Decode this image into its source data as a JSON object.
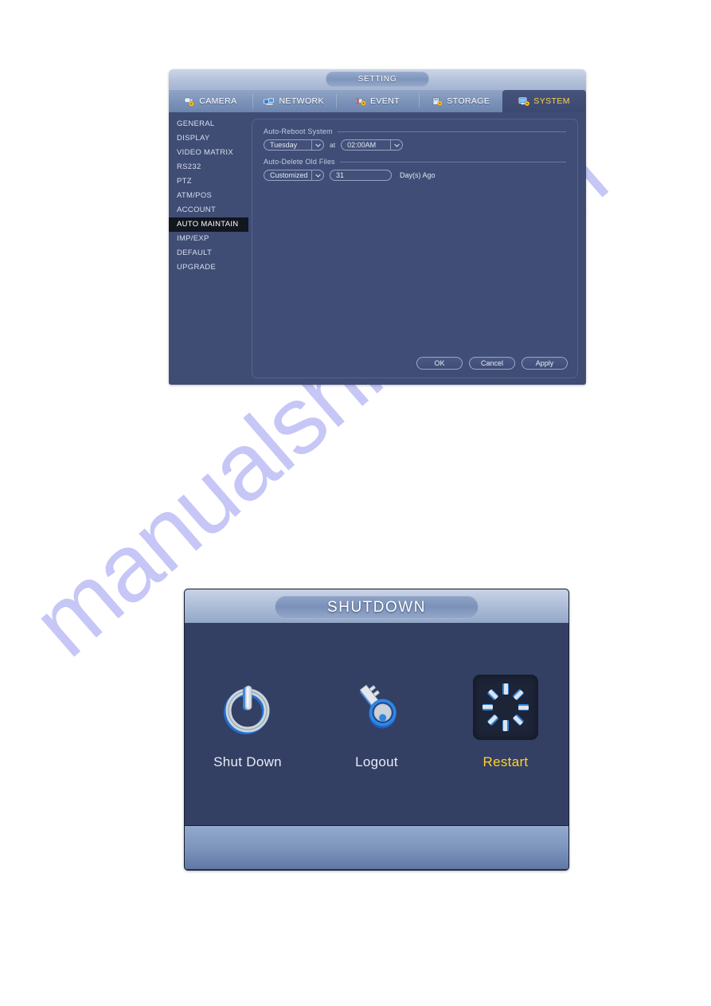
{
  "watermark": {
    "text": "manualshive.com"
  },
  "setting_window": {
    "title": "SETTING",
    "tabs": [
      {
        "label": "CAMERA",
        "icon": "camera-icon",
        "active": false
      },
      {
        "label": "NETWORK",
        "icon": "network-icon",
        "active": false
      },
      {
        "label": "EVENT",
        "icon": "event-icon",
        "active": false
      },
      {
        "label": "STORAGE",
        "icon": "storage-icon",
        "active": false
      },
      {
        "label": "SYSTEM",
        "icon": "system-icon",
        "active": true
      }
    ],
    "sidebar": {
      "items": [
        {
          "label": "GENERAL",
          "active": false
        },
        {
          "label": "DISPLAY",
          "active": false
        },
        {
          "label": "VIDEO MATRIX",
          "active": false
        },
        {
          "label": "RS232",
          "active": false
        },
        {
          "label": "PTZ",
          "active": false
        },
        {
          "label": "ATM/POS",
          "active": false
        },
        {
          "label": "ACCOUNT",
          "active": false
        },
        {
          "label": "AUTO MAINTAIN",
          "active": true
        },
        {
          "label": "IMP/EXP",
          "active": false
        },
        {
          "label": "DEFAULT",
          "active": false
        },
        {
          "label": "UPGRADE",
          "active": false
        }
      ]
    },
    "content": {
      "reboot_group_label": "Auto-Reboot System",
      "reboot_day_value": "Tuesday",
      "reboot_at_label": "at",
      "reboot_time_value": "02:00AM",
      "delete_group_label": "Auto-Delete Old Files",
      "delete_mode_value": "Customized",
      "delete_days_value": "31",
      "delete_days_unit": "Day(s) Ago"
    },
    "buttons": {
      "ok": "OK",
      "cancel": "Cancel",
      "apply": "Apply"
    },
    "colors": {
      "accent_yellow": "#ffd24a",
      "panel_blue": "#404e77",
      "titlebar_blue": "#b3c1da",
      "active_tab_blue": "#46547c"
    }
  },
  "shutdown_window": {
    "title": "SHUTDOWN",
    "options": [
      {
        "label": "Shut Down",
        "icon": "power-icon",
        "selected": false
      },
      {
        "label": "Logout",
        "icon": "key-icon",
        "selected": false
      },
      {
        "label": "Restart",
        "icon": "restart-icon",
        "selected": true
      }
    ],
    "colors": {
      "selected_label": "#ffd234",
      "body_bg": "#333f63",
      "selected_tile_bg": "#1d2437"
    }
  }
}
